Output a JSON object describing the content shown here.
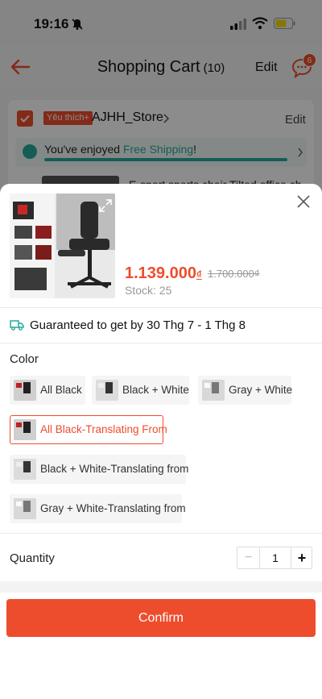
{
  "status_bar": {
    "time": "19:16"
  },
  "header": {
    "title": "Shopping Cart",
    "count": "(10)",
    "edit": "Edit",
    "chat_badge": "6"
  },
  "store": {
    "tag": "Yêu thích+",
    "name": "AJHH_Store",
    "edit": "Edit",
    "shipping_prefix": "You've enjoyed ",
    "shipping_free": "Free Shipping",
    "shipping_suffix": "!",
    "product_title": "E-sport sports chair Tilted office ch"
  },
  "sheet": {
    "price": "1.139.000",
    "currency": "₫",
    "old_price": "1.700.000₫",
    "stock": "Stock: 25",
    "guarantee": "Guaranteed to get by 30 Thg 7 - 1 Thg 8",
    "color_label": "Color",
    "options": [
      {
        "label": "All Black",
        "selected": false
      },
      {
        "label": "Black + White",
        "selected": false
      },
      {
        "label": "Gray + White",
        "selected": false
      },
      {
        "label": "All Black-Translating From",
        "selected": true
      },
      {
        "label": "Black + White-Translating from",
        "selected": false
      },
      {
        "label": "Gray + White-Translating from",
        "selected": false
      }
    ],
    "quantity_label": "Quantity",
    "quantity_minus": "−",
    "quantity": "1",
    "quantity_plus": "+",
    "confirm": "Confirm"
  },
  "colors": {
    "accent": "#ee4d2d",
    "shipping": "#26aa99"
  }
}
